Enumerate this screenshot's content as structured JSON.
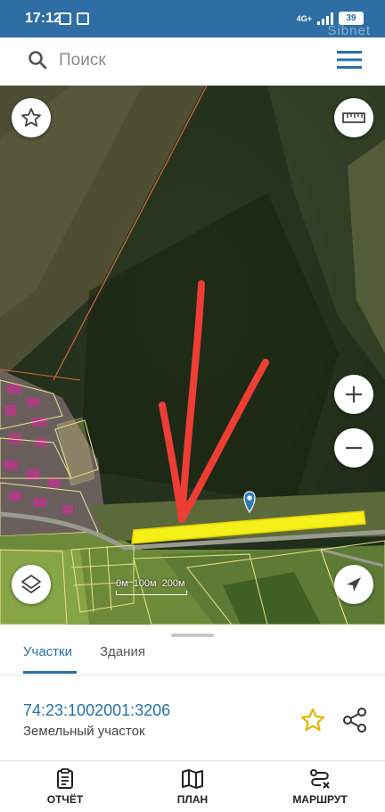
{
  "status_bar": {
    "time": "17:12",
    "battery": "39",
    "network": "4G+",
    "watermark": "Sibnet"
  },
  "search": {
    "placeholder": "Поиск"
  },
  "map": {
    "scale_labels": [
      "0м",
      "100м",
      "200м"
    ]
  },
  "tabs": [
    {
      "label": "Участки",
      "active": true
    },
    {
      "label": "Здания",
      "active": false
    }
  ],
  "parcel": {
    "cadastral_number": "74:23:1002001:3206",
    "type": "Земельный участок"
  },
  "bottom_nav": [
    {
      "label": "ОТЧЁТ",
      "icon": "clipboard-icon"
    },
    {
      "label": "ПЛАН",
      "icon": "map-icon"
    },
    {
      "label": "МАРШРУТ",
      "icon": "route-icon"
    }
  ],
  "colors": {
    "status_bar": "#2f6ea5",
    "accent": "#2a6fa8",
    "highlight": "#f5ef1a",
    "arrow": "#ee3d35",
    "parcel_outline": "#e8e58a"
  }
}
